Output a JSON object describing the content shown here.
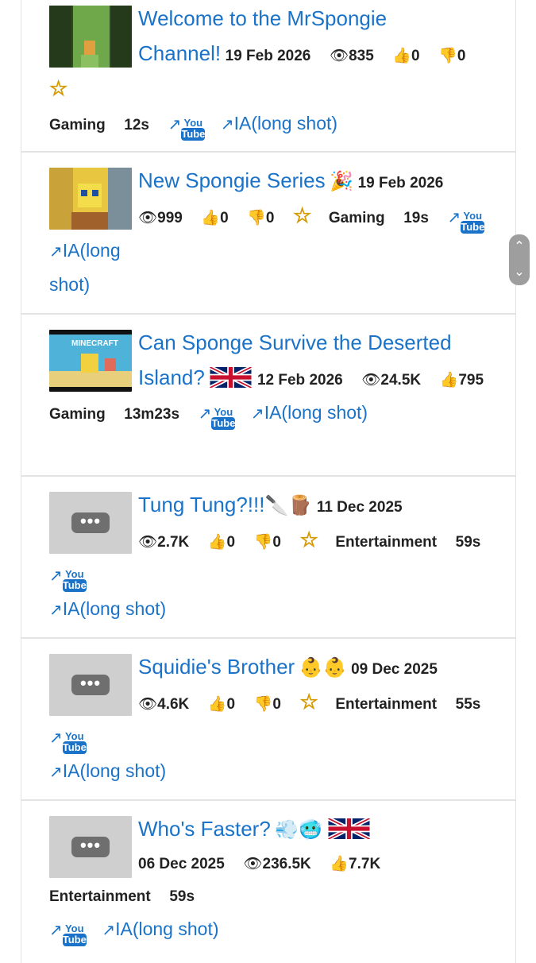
{
  "link_arrow": "↗",
  "yt_you": "You",
  "yt_tube": "Tube",
  "ia_label": "IA(long shot)",
  "ia_label_a": "IA(long",
  "ia_label_b": "shot)",
  "thumb_placeholder": "•••",
  "scroll": {
    "up": "⌃",
    "down": "⌄"
  },
  "icons": {
    "views": "👁",
    "like": "👍",
    "dislike": "👎",
    "star": "☆"
  },
  "colors": {
    "link": "#1a73c8",
    "star": "#f5c518",
    "placeholder": "#cfcfcf"
  },
  "videos": [
    {
      "title": "Welcome to the MrSpongie Channel!",
      "title_a": "Welcome to the MrSpongie",
      "title_b": "Channel!",
      "date": "19 Feb 2026",
      "views": "835",
      "likes": "0",
      "dislikes": "0",
      "category": "Gaming",
      "duration": "12s"
    },
    {
      "title": "New Spongie Series",
      "emoji": "🎉",
      "date": "19 Feb 2026",
      "views": "999",
      "likes": "0",
      "dislikes": "0",
      "category": "Gaming",
      "duration": "19s"
    },
    {
      "title_a": "Can Sponge Survive the Deserted",
      "title_b": "Island?",
      "date": "12 Feb 2026",
      "views": "24.5K",
      "likes": "795",
      "category": "Gaming",
      "duration": "13m23s",
      "thumb_text": "MINECRAFT"
    },
    {
      "title": "Tung Tung?!!!",
      "emoji": "🔪🪵",
      "date": "11 Dec 2025",
      "views": "2.7K",
      "likes": "0",
      "dislikes": "0",
      "category": "Entertainment",
      "duration": "59s"
    },
    {
      "title": "Squidie's Brother",
      "emoji": "👶👶",
      "date": "09 Dec 2025",
      "views": "4.6K",
      "likes": "0",
      "dislikes": "0",
      "category": "Entertainment",
      "duration": "55s"
    },
    {
      "title": "Who's Faster?",
      "emoji": "💨🥶",
      "date": "06 Dec 2025",
      "views": "236.5K",
      "likes": "7.7K",
      "category": "Entertainment",
      "duration": "59s"
    }
  ]
}
